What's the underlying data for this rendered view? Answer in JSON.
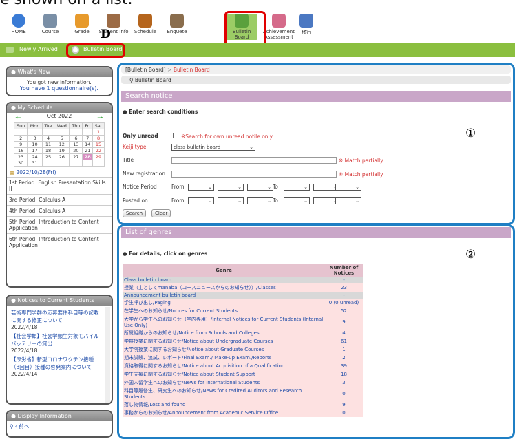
{
  "caption": "e shown on a list.",
  "nav": [
    {
      "label": "HOME",
      "icon": "home-icon"
    },
    {
      "label": "Course",
      "icon": "course-icon"
    },
    {
      "label": "Grade",
      "icon": "grade-icon"
    },
    {
      "label": "Student Info",
      "icon": "student-info-icon"
    },
    {
      "label": "Schedule",
      "icon": "schedule-icon"
    },
    {
      "label": "Enquete",
      "icon": "enquete-icon"
    },
    {
      "label": "Bulletin Board",
      "icon": "bulletin-board-icon"
    },
    {
      "label": "Achievement Assessment",
      "icon": "achievement-icon"
    },
    {
      "label": "移行",
      "icon": "transfer-icon"
    }
  ],
  "annotation_letter": "D",
  "tabs": {
    "newly_arrived": "Newly Arrived",
    "bulletin_board": "Bulletin Board"
  },
  "whats_new": {
    "title": "What's New",
    "line1": "You got new information.",
    "line2": "You have 1 questionnaire(s)."
  },
  "schedule": {
    "title": "My Schedule",
    "month": "Oct 2022",
    "weekdays": [
      "Sun",
      "Mon",
      "Tue",
      "Wed",
      "Thu",
      "Fri",
      "Sat"
    ],
    "weeks": [
      [
        "",
        "",
        "",
        "",
        "",
        "",
        "1"
      ],
      [
        "2",
        "3",
        "4",
        "5",
        "6",
        "7",
        "8"
      ],
      [
        "9",
        "10",
        "11",
        "12",
        "13",
        "14",
        "15"
      ],
      [
        "16",
        "17",
        "18",
        "19",
        "20",
        "21",
        "22"
      ],
      [
        "23",
        "24",
        "25",
        "26",
        "27",
        "28",
        "29"
      ],
      [
        "30",
        "31",
        "",
        "",
        "",
        "",
        ""
      ]
    ],
    "selected_date": "2022/10/28(Fri)",
    "periods": [
      "1st Period: English Presentation Skills II",
      "3rd Period: Calculus A",
      "4th Period: Calculus A",
      "5th Period: Introduction to Content Application",
      "6th Period: Introduction to Content Application"
    ]
  },
  "notices": {
    "title": "Notices to Current Students",
    "items": [
      {
        "text": "芸術専門学群の応募要件科目等の記載に関する修正について",
        "date": "2022/4/18"
      },
      {
        "text": "【社会学類】社会学類生対象モバイルバッテリーの貸出",
        "date": "2022/4/18"
      },
      {
        "text": "【厚労省】新型コロナワクチン接種（3回目）接種の啓発案内について",
        "date": "2022/4/14"
      }
    ]
  },
  "display_info": {
    "title": "Display Information",
    "prev": "前へ"
  },
  "breadcrumb": {
    "root": "[Bulletin Board]",
    "sep": ">",
    "current": "Bulletin Board"
  },
  "subcrumb": "Bulletin Board",
  "search": {
    "title": "Search notice",
    "subtitle": "Enter search conditions",
    "only_unread_label": "Only unread",
    "only_unread_note": "※Search for own unread notile only.",
    "keiji_type_label": "Keiji type",
    "keiji_type_value": "class bulletin board",
    "title_label": "Title",
    "match_partially": "※ Match partially",
    "new_registration_label": "New registration",
    "notice_period_label": "Notice Period",
    "posted_on_label": "Posted on",
    "from": "From",
    "to": "To",
    "search_btn": "Search",
    "clear_btn": "Clear"
  },
  "marker1": "①",
  "marker2": "②",
  "genres": {
    "title": "List of genres",
    "subtitle": "For details, click on genres",
    "col_genre": "Genre",
    "col_number": "Number of Notices",
    "rows": [
      {
        "kind": "cat",
        "name": "Class bulletin board",
        "count": "-"
      },
      {
        "kind": "row",
        "name": "授業（主としてmanaba（コースニュースからのお知らせ））/Classes",
        "count": "23"
      },
      {
        "kind": "cat",
        "name": "Announcement bulletin board",
        "count": "-"
      },
      {
        "kind": "row",
        "name": "学生呼び出し/Paging",
        "count": "0 (0 unread)"
      },
      {
        "kind": "row",
        "name": "在学生へのお知らせ/Notices for Current Students",
        "count": "52"
      },
      {
        "kind": "row",
        "name": "大学から学生へのお知らせ（学内専用）/Internal Notices for Current Students (Internal Use Only)",
        "count": "9"
      },
      {
        "kind": "row",
        "name": "所属組織からのお知らせ/Notice from Schools and Colleges",
        "count": "4"
      },
      {
        "kind": "row",
        "name": "学群授業に関するお知らせ/Notice about Undergraduate Courses",
        "count": "61"
      },
      {
        "kind": "row",
        "name": "大学院授業に関するお知らせ/Notice about Graduate Courses",
        "count": "1"
      },
      {
        "kind": "row",
        "name": "期末試験、追試、レポート/Final Exam./ Make-up Exam./Reports",
        "count": "2"
      },
      {
        "kind": "row",
        "name": "資格取得に関するお知らせ/Notice about Acquisition of a Qualification",
        "count": "39"
      },
      {
        "kind": "row",
        "name": "学生支援に関するお知らせ/Notice about Student Support",
        "count": "18"
      },
      {
        "kind": "row",
        "name": "外国人留学生へのお知らせ/News for International Students",
        "count": "3"
      },
      {
        "kind": "row",
        "name": "科目等履修生、研究生へのお知らせ/News for Credited Auditors and Research Students",
        "count": "0"
      },
      {
        "kind": "row",
        "name": "落し物情報/Lost and found",
        "count": "9"
      },
      {
        "kind": "row",
        "name": "事務からのお知らせ/Announcement from Academic Service Office",
        "count": "0"
      }
    ]
  }
}
